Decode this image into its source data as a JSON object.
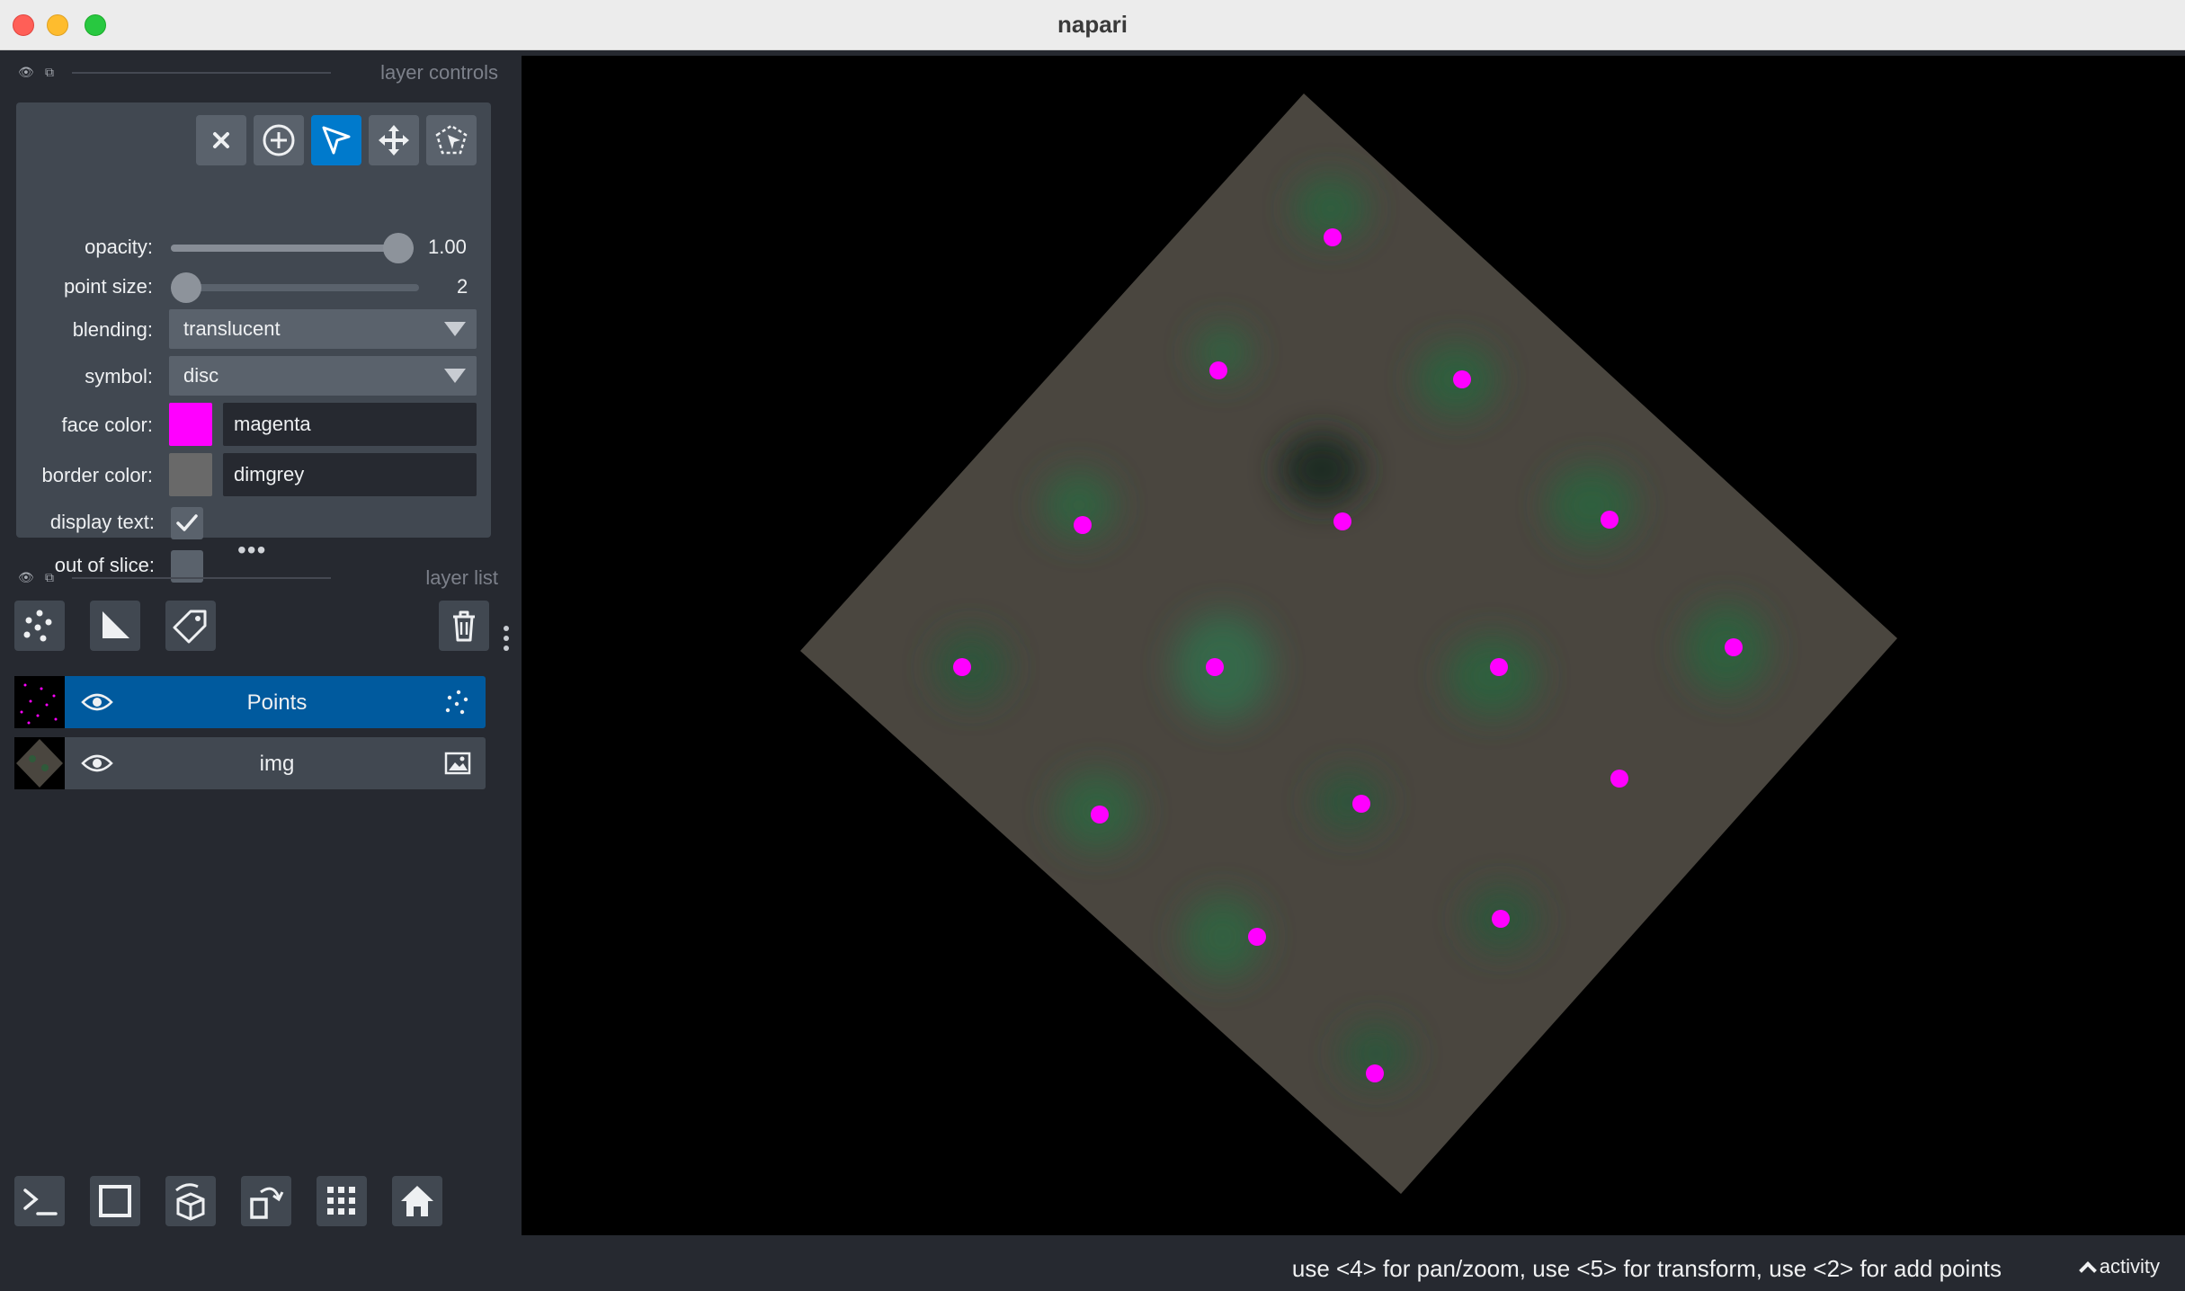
{
  "window": {
    "title": "napari"
  },
  "layer_controls": {
    "header": "layer controls",
    "tools": [
      {
        "name": "delete-selected",
        "icon": "close-icon"
      },
      {
        "name": "add-points",
        "icon": "add-circle-icon"
      },
      {
        "name": "select-points",
        "icon": "pointer-icon",
        "active": true
      },
      {
        "name": "pan-zoom",
        "icon": "move-icon"
      },
      {
        "name": "transform",
        "icon": "transform-icon"
      }
    ],
    "opacity": {
      "label": "opacity:",
      "value": 1.0,
      "display": "1.00"
    },
    "point_size": {
      "label": "point size:",
      "value": 2,
      "display": "2",
      "fraction": 0.03
    },
    "blending": {
      "label": "blending:",
      "value": "translucent"
    },
    "symbol": {
      "label": "symbol:",
      "value": "disc"
    },
    "face_color": {
      "label": "face color:",
      "value": "magenta",
      "swatch": "#ff00ff"
    },
    "border_color": {
      "label": "border color:",
      "value": "dimgrey",
      "swatch": "#696969"
    },
    "display_text": {
      "label": "display text:",
      "checked": true
    },
    "out_of_slice": {
      "label": "out of slice:",
      "checked": false
    }
  },
  "layer_list": {
    "header": "layer list",
    "layers": [
      {
        "name": "Points",
        "selected": true,
        "type_icon": "points-icon",
        "visible": true
      },
      {
        "name": "img",
        "selected": false,
        "type_icon": "image-icon",
        "visible": true
      }
    ]
  },
  "status": {
    "message": "use <4> for pan/zoom, use <5> for transform, use <2> for add points",
    "activity": "activity"
  },
  "colors": {
    "accent": "#007acc",
    "selected_layer": "#005a9e",
    "point_face": "#ff00ff",
    "image_tissue": "#4a463f"
  }
}
